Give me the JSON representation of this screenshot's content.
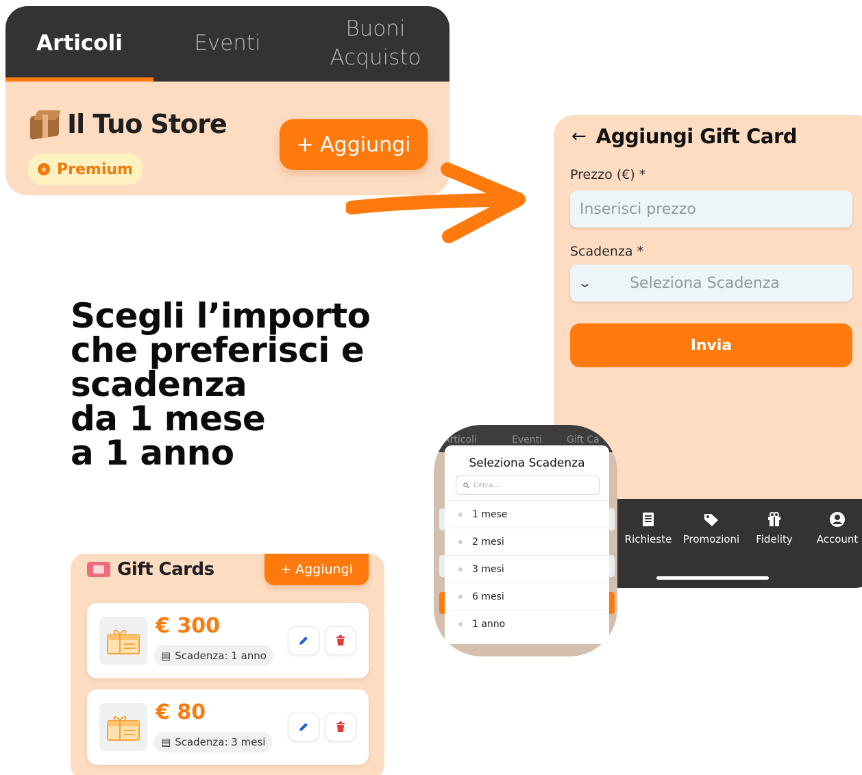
{
  "colors": {
    "accent": "#ff7a0d",
    "panel_bg": "#fddcc2",
    "bar_bg": "#333333"
  },
  "store": {
    "tabs": [
      {
        "label": "Articoli",
        "active": true
      },
      {
        "label": "Eventi",
        "active": false
      },
      {
        "label": "Buoni\nAcquisto",
        "active": false
      }
    ],
    "title": "Il Tuo Store",
    "title_icon": "package-icon",
    "badge": "Premium",
    "add_button": "+ Aggiungi"
  },
  "headline": {
    "lines": [
      "Scegli l’importo",
      "che preferisci e",
      "scadenza",
      "da 1 mese",
      "a 1 anno"
    ]
  },
  "form": {
    "title": "Aggiungi Gift Card",
    "price_label": "Prezzo (€) *",
    "price_placeholder": "Inserisci prezzo",
    "expiry_label": "Scadenza *",
    "expiry_placeholder": "Seleziona Scadenza",
    "submit": "Invia",
    "nav": [
      {
        "label": "Richieste",
        "icon": "receipt-icon"
      },
      {
        "label": "Promozioni",
        "icon": "tag-icon"
      },
      {
        "label": "Fidelity",
        "icon": "gift-icon"
      },
      {
        "label": "Account",
        "icon": "account-icon"
      }
    ]
  },
  "modal": {
    "bg_tabs": [
      "Articoli",
      "Eventi",
      "Gift Ca"
    ],
    "title": "Seleziona Scadenza",
    "search_placeholder": "Cerca...",
    "options": [
      "1 mese",
      "2 mesi",
      "3 mesi",
      "6 mesi",
      "1 anno"
    ]
  },
  "gift_cards": {
    "title": "Gift Cards",
    "add_button": "+ Aggiungi",
    "items": [
      {
        "price": "€ 300",
        "expiry": "Scadenza: 1 anno"
      },
      {
        "price": "€ 80",
        "expiry": "Scadenza: 3 mesi"
      }
    ]
  }
}
